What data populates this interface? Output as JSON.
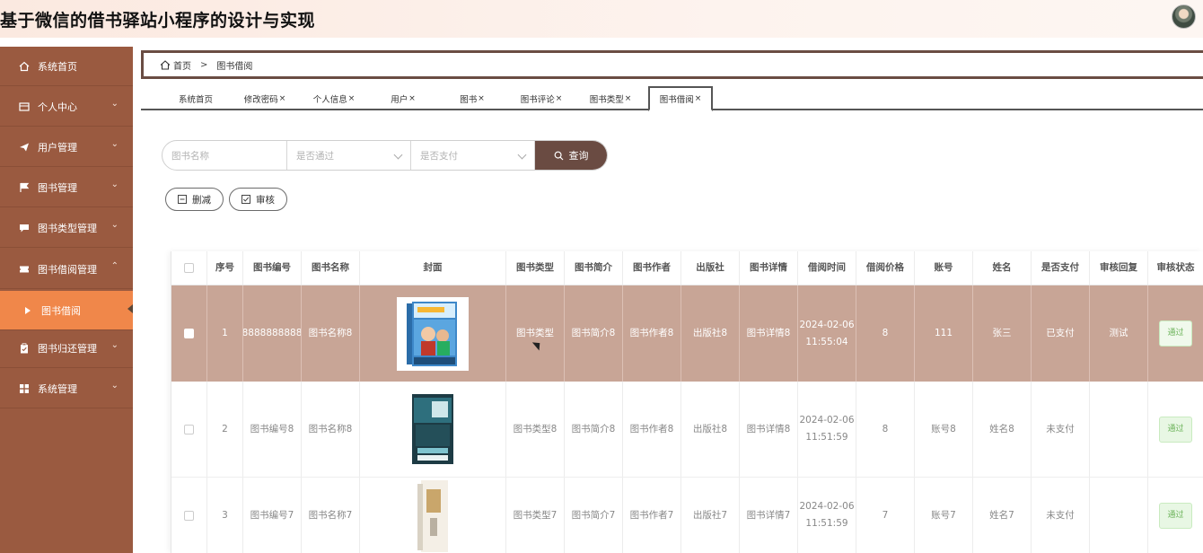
{
  "app": {
    "title": "基于微信的借书驿站小程序的设计与实现"
  },
  "sidebar": {
    "items": [
      {
        "label": "系统首页",
        "icon": "home-icon",
        "has_submenu": false
      },
      {
        "label": "个人中心",
        "icon": "profile-icon",
        "has_submenu": true
      },
      {
        "label": "用户管理",
        "icon": "send-icon",
        "has_submenu": true
      },
      {
        "label": "图书管理",
        "icon": "flag-icon",
        "has_submenu": true
      },
      {
        "label": "图书类型管理",
        "icon": "chat-icon",
        "has_submenu": true
      },
      {
        "label": "图书借阅管理",
        "icon": "ticket-icon",
        "has_submenu": true,
        "expanded": true
      },
      {
        "label": "图书借阅",
        "icon": "caret-right-icon",
        "sub": true,
        "active": true
      },
      {
        "label": "图书归还管理",
        "icon": "clipboard-icon",
        "has_submenu": true
      },
      {
        "label": "系统管理",
        "icon": "grid-icon",
        "has_submenu": true
      }
    ]
  },
  "breadcrumb": {
    "home": "首页",
    "current": "图书借阅"
  },
  "tabs": [
    {
      "label": "系统首页",
      "closable": false
    },
    {
      "label": "修改密码",
      "closable": true
    },
    {
      "label": "个人信息",
      "closable": true
    },
    {
      "label": "用户",
      "closable": true
    },
    {
      "label": "图书",
      "closable": true
    },
    {
      "label": "图书评论",
      "closable": true
    },
    {
      "label": "图书类型",
      "closable": true
    },
    {
      "label": "图书借阅",
      "closable": true,
      "active": true
    }
  ],
  "tab_close_glyph": "×",
  "search": {
    "name_placeholder": "图书名称",
    "passed_placeholder": "是否通过",
    "paid_placeholder": "是否支付",
    "button_label": "查询"
  },
  "actions": {
    "delete_label": "删减",
    "review_label": "审核"
  },
  "table": {
    "columns": [
      "序号",
      "图书编号",
      "图书名称",
      "封面",
      "图书类型",
      "图书简介",
      "图书作者",
      "出版社",
      "图书详情",
      "借阅时间",
      "借阅价格",
      "账号",
      "姓名",
      "是否支付",
      "审核回复",
      "审核状态"
    ],
    "rows": [
      {
        "index": "1",
        "book_no": "8888888888",
        "book_name": "图书名称8",
        "type": "图书类型",
        "intro": "图书简介8",
        "author": "图书作者8",
        "publisher": "出版社8",
        "detail": "图书详情8",
        "time": "2024-02-06 11:55:04",
        "price": "8",
        "account": "111",
        "name": "张三",
        "paid": "已支付",
        "reply": "测试",
        "status": "通过",
        "selected": true
      },
      {
        "index": "2",
        "book_no": "图书编号8",
        "book_name": "图书名称8",
        "type": "图书类型8",
        "intro": "图书简介8",
        "author": "图书作者8",
        "publisher": "出版社8",
        "detail": "图书详情8",
        "time": "2024-02-06 11:51:59",
        "price": "8",
        "account": "账号8",
        "name": "姓名8",
        "paid": "未支付",
        "reply": "",
        "status": "通过",
        "selected": false
      },
      {
        "index": "3",
        "book_no": "图书编号7",
        "book_name": "图书名称7",
        "type": "图书类型7",
        "intro": "图书简介7",
        "author": "图书作者7",
        "publisher": "出版社7",
        "detail": "图书详情7",
        "time": "2024-02-06 11:51:59",
        "price": "7",
        "account": "账号7",
        "name": "姓名7",
        "paid": "未支付",
        "reply": "",
        "status": "通过",
        "selected": false
      }
    ]
  },
  "colors": {
    "sidebar": "#9a5a40",
    "sidebar_active": "#f0874a",
    "accent_dark": "#6a4b42",
    "selected_row": "#c8a596",
    "status_green": "#6cb35a"
  }
}
